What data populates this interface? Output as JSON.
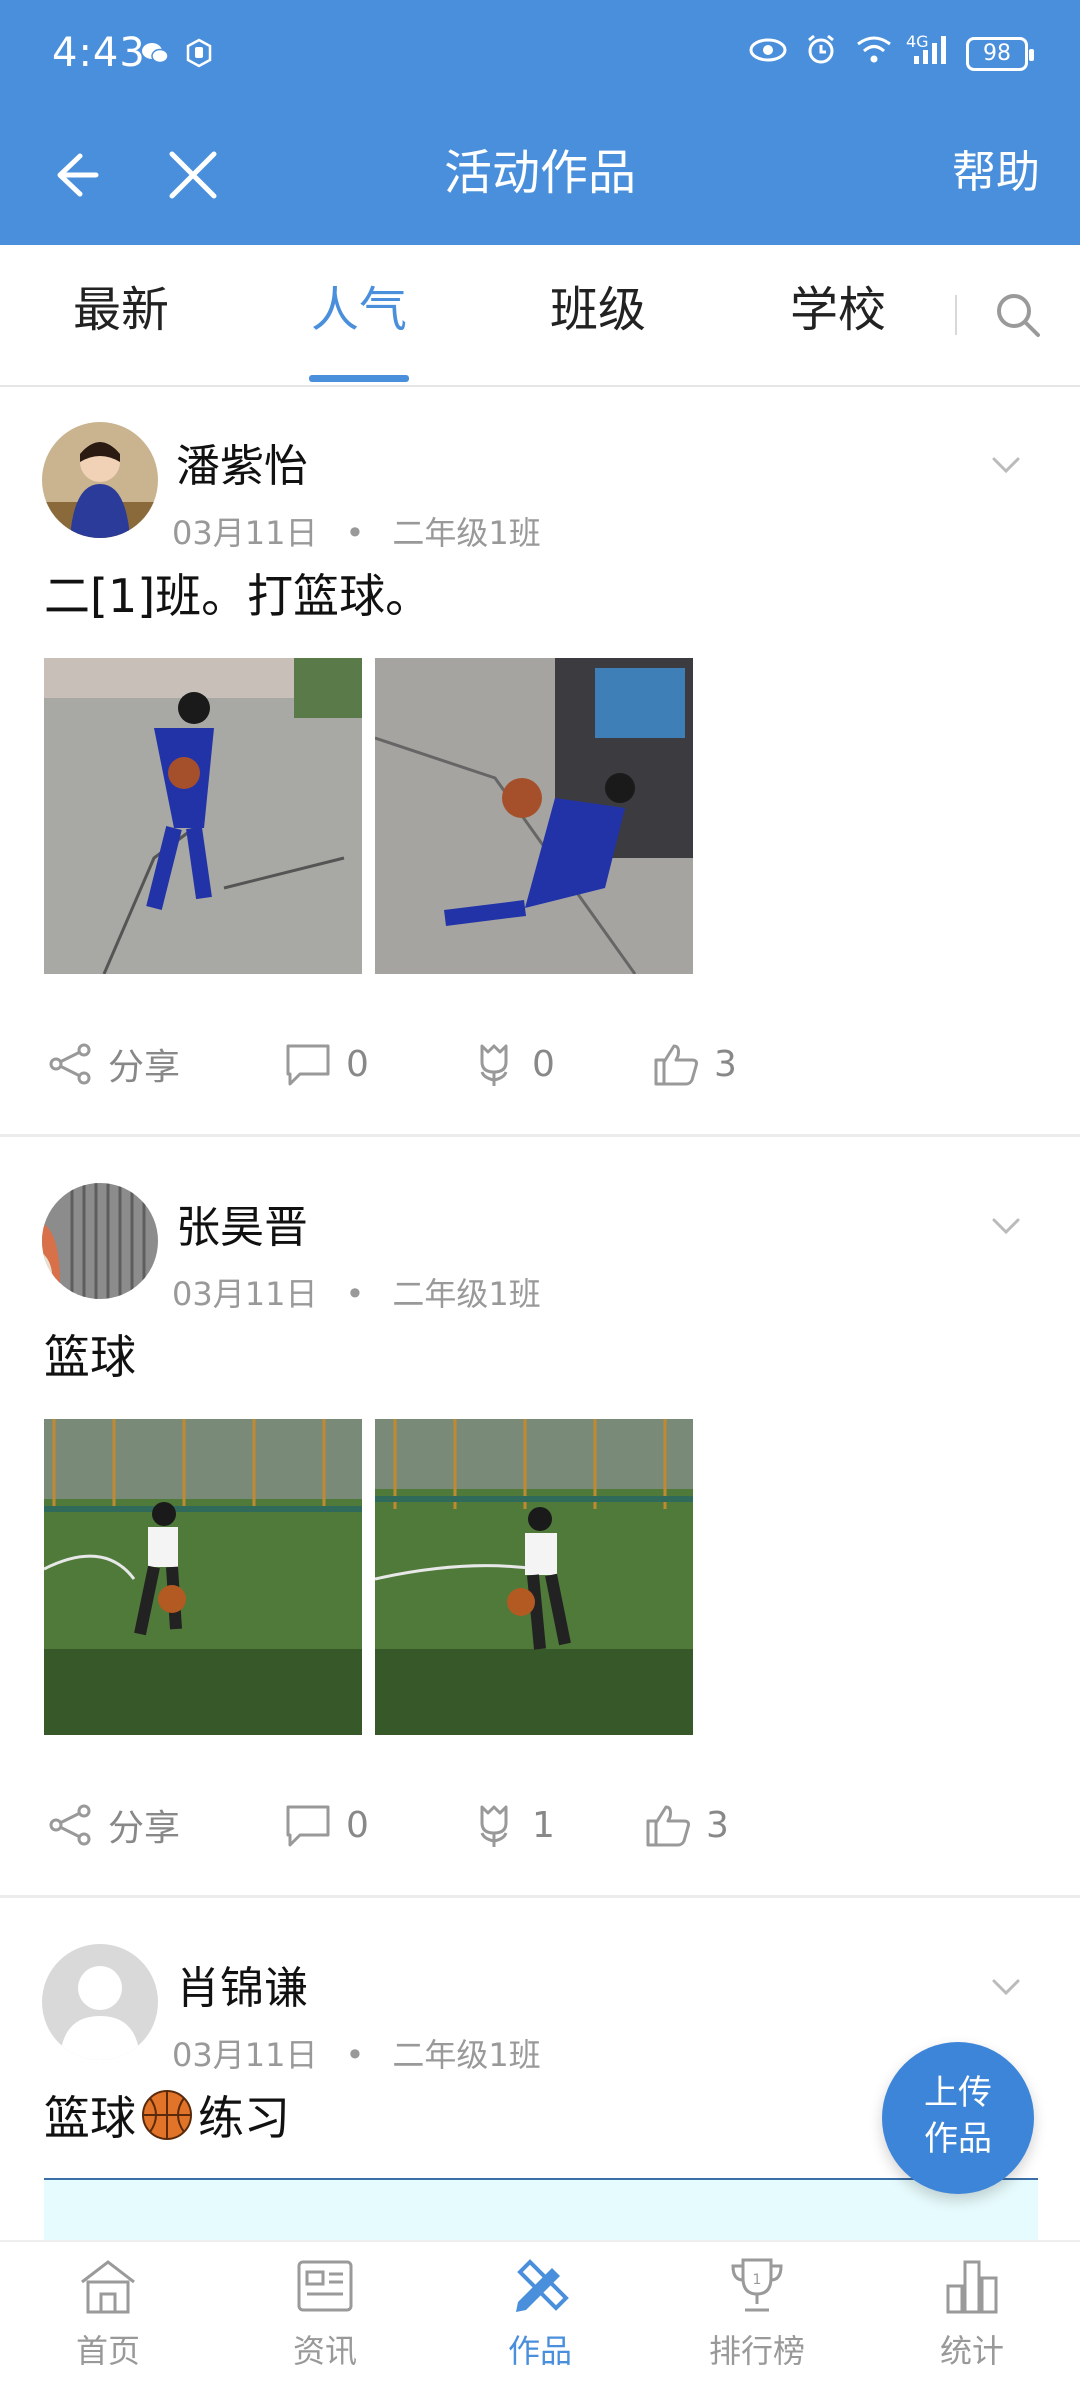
{
  "status": {
    "time": "4:43",
    "network": "4G",
    "battery": "98"
  },
  "header": {
    "title": "活动作品",
    "help": "帮助"
  },
  "tabs": [
    {
      "label": "最新"
    },
    {
      "label": "人气"
    },
    {
      "label": "班级"
    },
    {
      "label": "学校"
    }
  ],
  "active_tab": "人气",
  "posts": [
    {
      "name": "潘紫怡",
      "date": "03月11日",
      "class": "二年级1班",
      "text": "二[1]班。打篮球。",
      "share_label": "分享",
      "comments": "0",
      "flowers": "0",
      "likes": "3"
    },
    {
      "name": "张昊晋",
      "date": "03月11日",
      "class": "二年级1班",
      "text": "篮球",
      "share_label": "分享",
      "comments": "0",
      "flowers": "1",
      "likes": "3"
    },
    {
      "name": "肖锦谦",
      "date": "03月11日",
      "class": "二年级1班",
      "text_a": "篮球",
      "text_b": "练习"
    }
  ],
  "fab": {
    "line1": "上传",
    "line2": "作品"
  },
  "bottom_nav": [
    {
      "label": "首页",
      "icon": "home-icon"
    },
    {
      "label": "资讯",
      "icon": "news-icon"
    },
    {
      "label": "作品",
      "icon": "works-icon"
    },
    {
      "label": "排行榜",
      "icon": "trophy-icon"
    },
    {
      "label": "统计",
      "icon": "stats-icon"
    }
  ],
  "colors": {
    "accent": "#4a8fdc",
    "header_bg": "#4a8fdc"
  }
}
